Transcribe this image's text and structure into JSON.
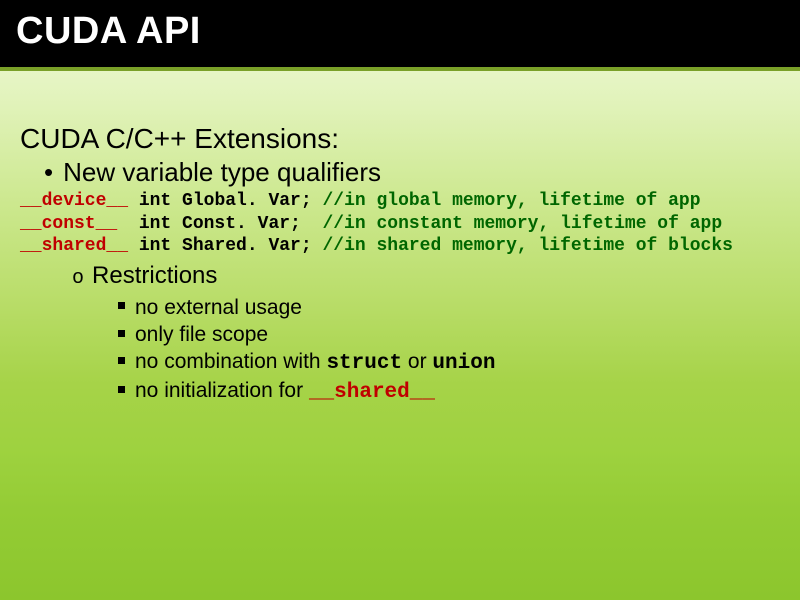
{
  "title": "CUDA API",
  "subtitle": "CUDA C/C++ Extensions:",
  "bullet_main": "New variable type qualifiers",
  "code": {
    "lines": [
      {
        "kw": "__device__",
        "mid": " int Global. Var; ",
        "comment": "//in global memory, lifetime of app"
      },
      {
        "kw": "__const__",
        "mid": "  int Const. Var;  ",
        "comment": "//in constant memory, lifetime of app"
      },
      {
        "kw": "__shared__",
        "mid": " int Shared. Var; ",
        "comment": "//in shared memory, lifetime of blocks"
      }
    ]
  },
  "restrictions": {
    "heading": "Restrictions",
    "items": [
      {
        "pre": "no external usage",
        "mono": "",
        "post": ""
      },
      {
        "pre": "only file scope",
        "mono": "",
        "post": ""
      },
      {
        "pre": "no combination with ",
        "mono": "struct",
        "post_mid": " or ",
        "mono2": "union",
        "post": ""
      },
      {
        "pre": "no initialization for ",
        "mono": "__shared__",
        "mono_red": true,
        "post": ""
      }
    ]
  }
}
